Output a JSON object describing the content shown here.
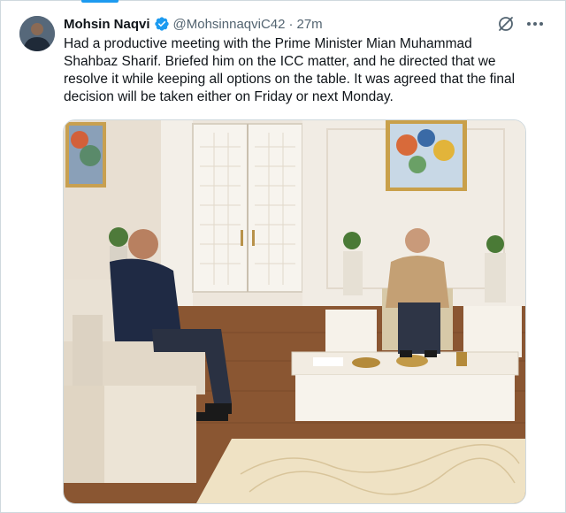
{
  "tweet": {
    "author_name": "Mohsin Naqvi",
    "handle": "@MohsinnaqviC42",
    "separator": "·",
    "time": "27m",
    "text": "Had a productive meeting with the Prime Minister Mian Muhammad\nShahbaz Sharif. Briefed him on the ICC matter, and he directed that we\nresolve it while keeping all options on the table. It was agreed that the final\ndecision will be taken either on Friday or next Monday.",
    "verified": true
  },
  "icons": {
    "verified": "verified-badge-icon",
    "grok": "grok-icon",
    "more": "more-options-icon"
  },
  "colors": {
    "accent": "#1d9bf0",
    "text_primary": "#0f1419",
    "text_secondary": "#536471",
    "border": "#cfd9de"
  }
}
